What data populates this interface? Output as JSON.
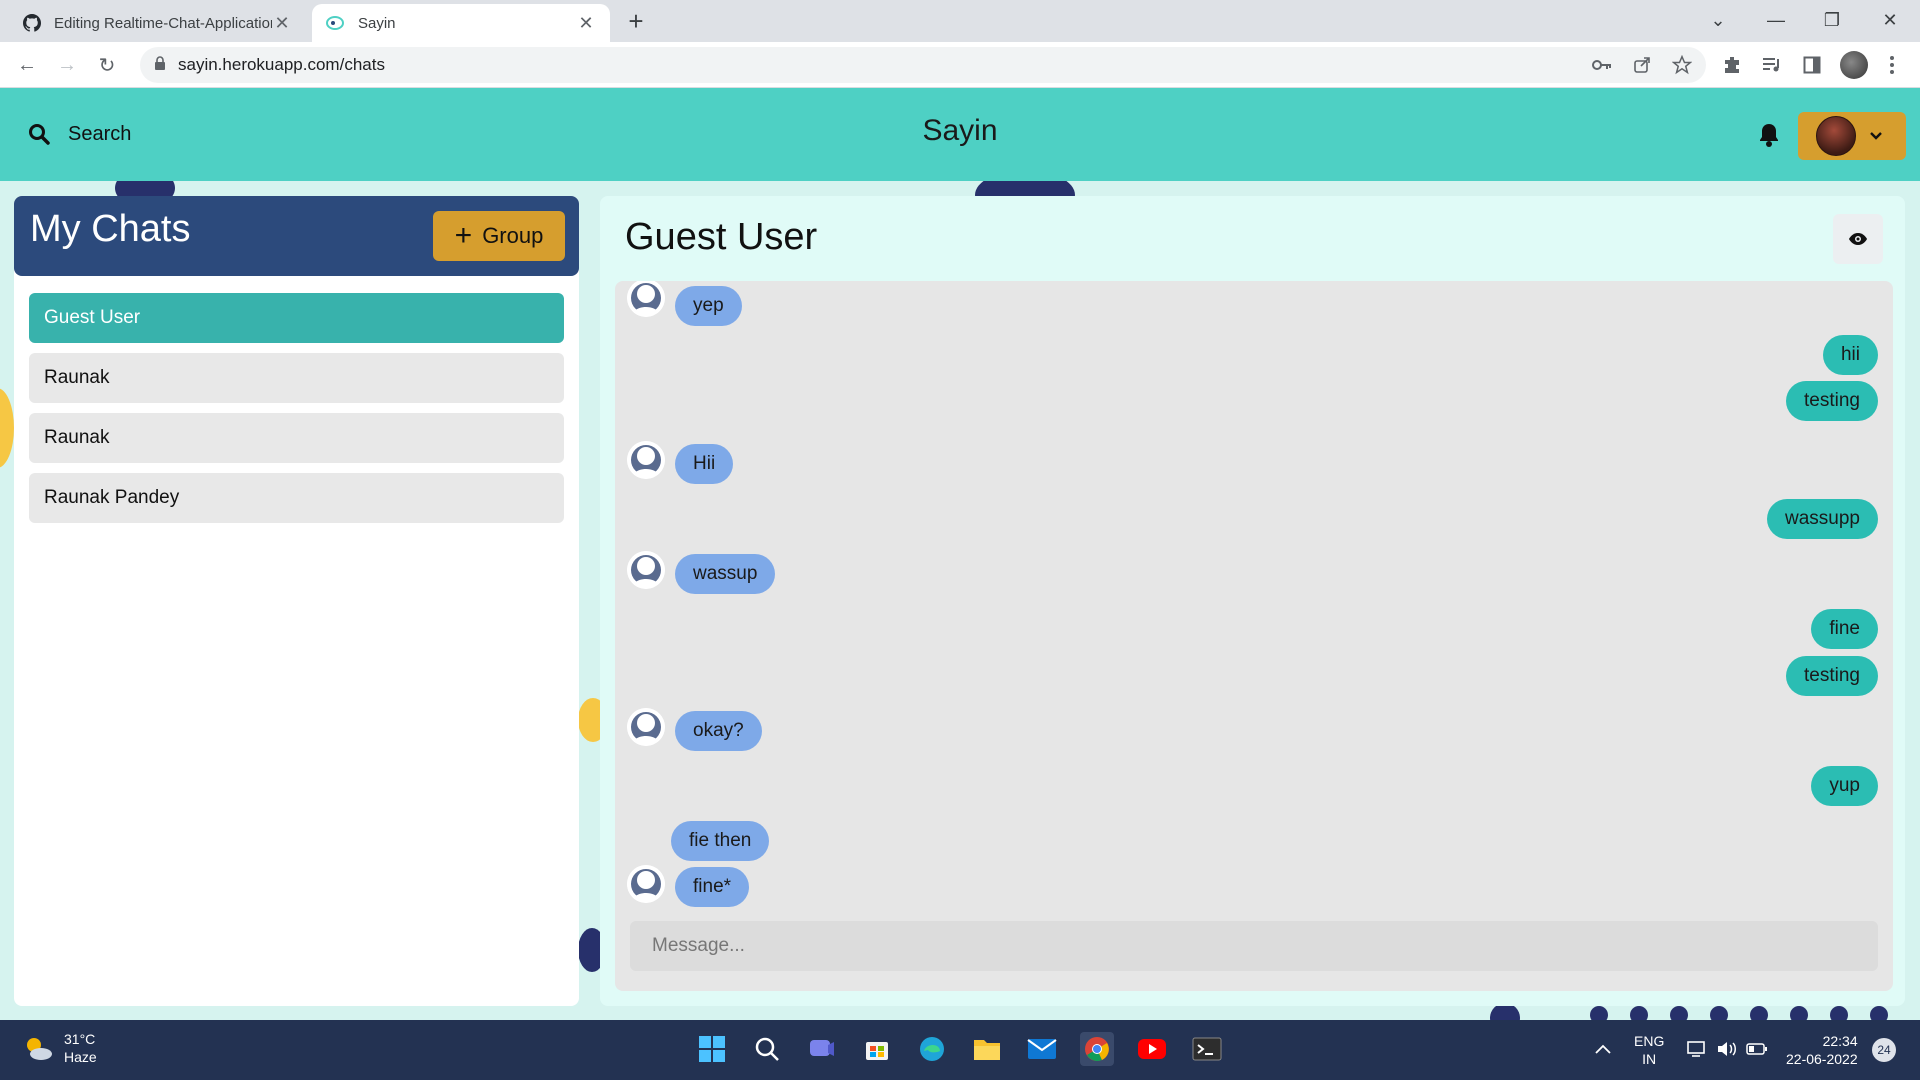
{
  "browser": {
    "tabs": [
      {
        "title": "Editing Realtime-Chat-Application",
        "icon": "github-icon"
      },
      {
        "title": "Sayin",
        "icon": "sayin-favicon"
      }
    ],
    "url": "sayin.herokuapp.com/chats"
  },
  "app": {
    "search_label": "Search",
    "title": "Sayin"
  },
  "sidebar": {
    "title": "My Chats",
    "group_button_label": "Group",
    "chats": [
      {
        "name": "Guest User",
        "selected": true
      },
      {
        "name": "Raunak",
        "selected": false
      },
      {
        "name": "Raunak",
        "selected": false
      },
      {
        "name": "Raunak Pandey",
        "selected": false
      }
    ]
  },
  "chat": {
    "header": "Guest User",
    "messages": [
      {
        "text": "yep",
        "from": "other",
        "avatar": true
      },
      {
        "text": "hii",
        "from": "me"
      },
      {
        "text": "testing",
        "from": "me"
      },
      {
        "text": "Hii",
        "from": "other",
        "avatar": true
      },
      {
        "text": "wassupp",
        "from": "me"
      },
      {
        "text": "wassup",
        "from": "other",
        "avatar": true
      },
      {
        "text": "fine",
        "from": "me"
      },
      {
        "text": "testing",
        "from": "me"
      },
      {
        "text": "okay?",
        "from": "other",
        "avatar": true
      },
      {
        "text": "yup",
        "from": "me"
      },
      {
        "text": "fie then",
        "from": "other",
        "avatar": false
      },
      {
        "text": "fine*",
        "from": "other",
        "avatar": true
      }
    ],
    "input_placeholder": "Message..."
  },
  "taskbar": {
    "weather_temp": "31°C",
    "weather_desc": "Haze",
    "lang_top": "ENG",
    "lang_bottom": "IN",
    "time": "22:34",
    "date": "22-06-2022",
    "notification_count": "24"
  },
  "colors": {
    "topnav": "#4ed0c4",
    "sidebar_header": "#2c4a7c",
    "accent_button": "#d69e2e",
    "selected_chat": "#38b2ac",
    "sent_bubble": "#2bbdb3",
    "received_bubble": "#7ea9e8"
  }
}
